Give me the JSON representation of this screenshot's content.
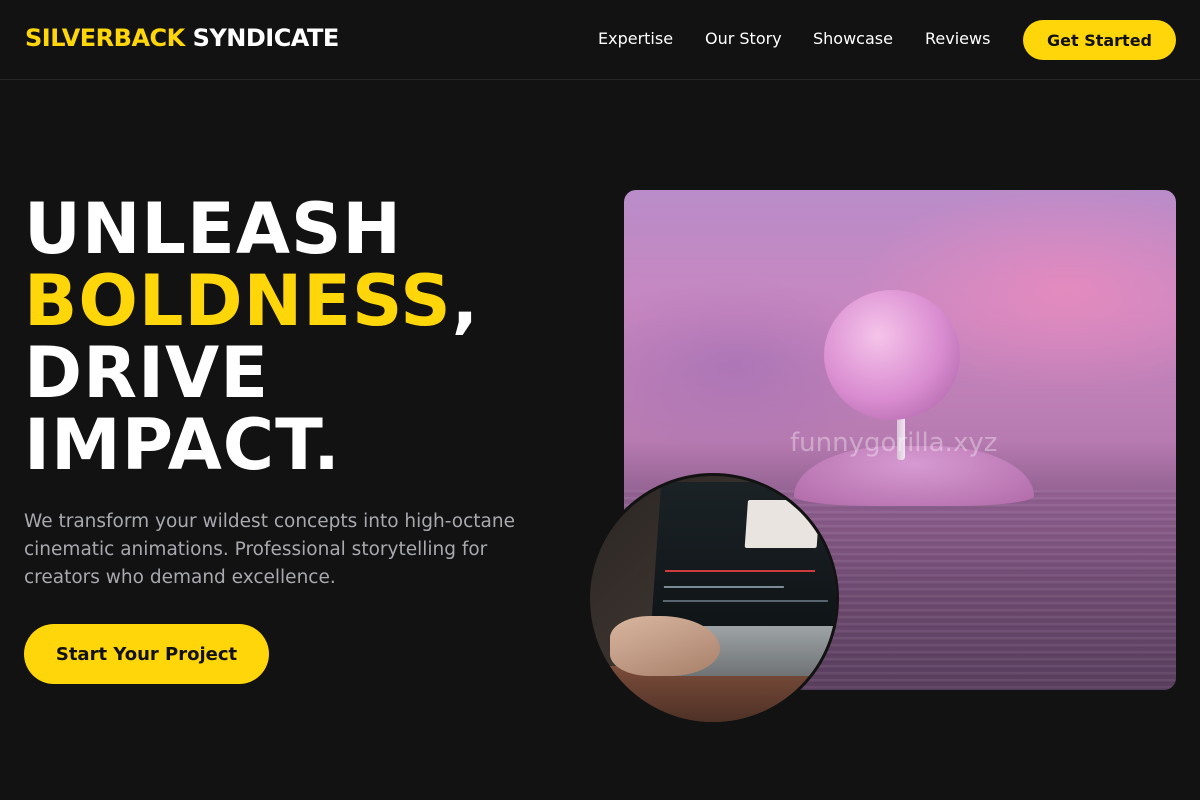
{
  "header": {
    "logo_accent": "SILVERBACK",
    "logo_rest": "SYNDICATE",
    "nav": [
      {
        "label": "Expertise"
      },
      {
        "label": "Our Story"
      },
      {
        "label": "Showcase"
      },
      {
        "label": "Reviews"
      }
    ],
    "cta_label": "Get Started"
  },
  "hero": {
    "headline_line1": "UNLEASH",
    "headline_highlight": "BOLDNESS",
    "headline_comma": ",",
    "headline_line3": "DRIVE",
    "headline_line4": "IMPACT.",
    "subtitle": "We transform your wildest concepts into high-octane cinematic animations. Professional storytelling for creators who demand excellence.",
    "cta_label": "Start Your Project",
    "image_watermark": "funnygorilla.xyz"
  },
  "colors": {
    "accent": "#FFD60A",
    "background": "#121212",
    "text_muted": "#a7a9ae"
  }
}
